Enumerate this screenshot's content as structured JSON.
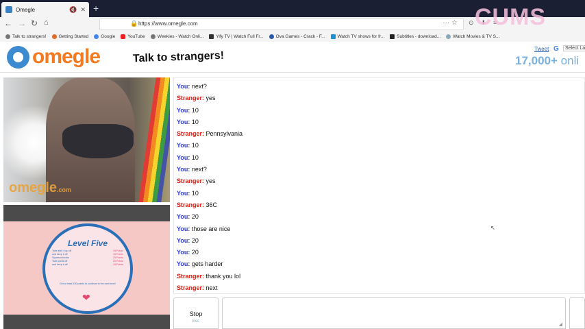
{
  "browser": {
    "tab_title": "Omegle",
    "tab_mute_icon": "speaker-muted-icon",
    "tab_close": "✕",
    "new_tab": "+",
    "url": "https://www.omegle.com",
    "bookmarks": [
      "Talk to strangers!",
      "Getting Started",
      "Google",
      "YouTube",
      "Weekies - Watch Onli...",
      "Yify TV | Watch Full Fr...",
      "Ova Games - Crack - F...",
      "Watch TV shows for fr...",
      "Subtitles - download...",
      "Watch Movies & TV S..."
    ]
  },
  "header": {
    "logo": "omegle",
    "tagline": "Talk to strangers!",
    "tweet": "Tweet",
    "select_language": "Select La",
    "online_count": "17,000+",
    "online_suffix": "onli",
    "watermark": "CUMS"
  },
  "stranger_video": {
    "logo": "omegle",
    "logo_suffix": ".com"
  },
  "self_video": {
    "level_title": "Level Five",
    "rules": [
      {
        "text": "Take shirt / top off",
        "points": "15 Points"
      },
      {
        "text": "and keep it off",
        "points": "15 Points"
      },
      {
        "text": "Squeeze boobs",
        "points": "25 Points"
      },
      {
        "text": "Take pants off",
        "points": "20 Points"
      },
      {
        "text": "and keep it off",
        "points": "15 Points"
      }
    ],
    "note": "Get at least 150 points to continue to the next level!"
  },
  "chat": {
    "you_label": "You:",
    "stranger_label": "Stranger:",
    "messages": [
      {
        "who": "You",
        "text": "next?"
      },
      {
        "who": "Stranger",
        "text": "yes"
      },
      {
        "who": "You",
        "text": "10"
      },
      {
        "who": "You",
        "text": "10"
      },
      {
        "who": "Stranger",
        "text": "Pennsylvania"
      },
      {
        "who": "You",
        "text": "10"
      },
      {
        "who": "You",
        "text": "10"
      },
      {
        "who": "You",
        "text": "next?"
      },
      {
        "who": "Stranger",
        "text": "yes"
      },
      {
        "who": "You",
        "text": "10"
      },
      {
        "who": "Stranger",
        "text": "36C"
      },
      {
        "who": "You",
        "text": "20"
      },
      {
        "who": "You",
        "text": "those are nice"
      },
      {
        "who": "You",
        "text": "20"
      },
      {
        "who": "You",
        "text": "20"
      },
      {
        "who": "You",
        "text": "gets harder"
      },
      {
        "who": "Stranger",
        "text": "thank you lol"
      },
      {
        "who": "Stranger",
        "text": "next"
      }
    ]
  },
  "controls": {
    "stop_label": "Stop",
    "stop_sub": "Esc"
  }
}
